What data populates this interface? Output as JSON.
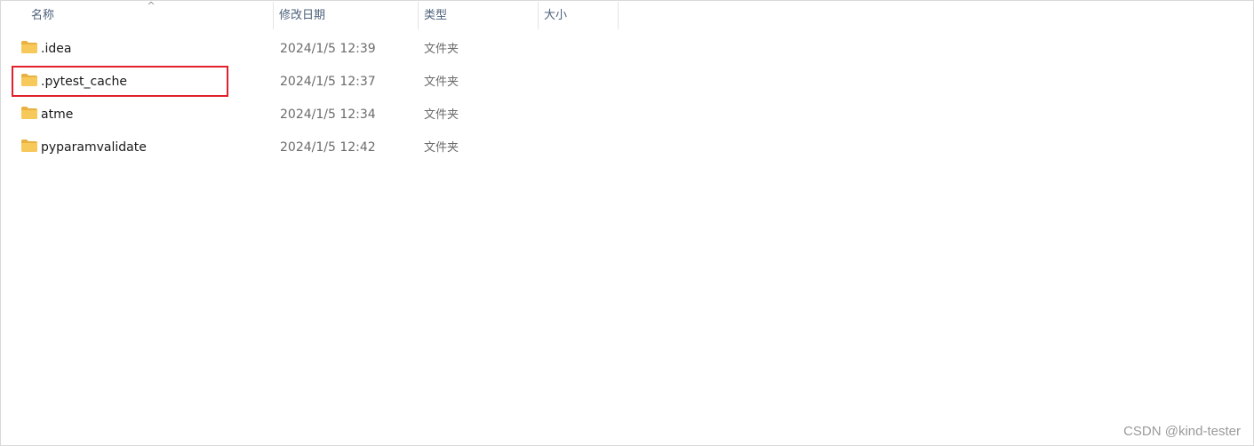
{
  "columns": {
    "name": "名称",
    "date": "修改日期",
    "type": "类型",
    "size": "大小"
  },
  "sort_indicator": "^",
  "files": [
    {
      "name": ".idea",
      "date": "2024/1/5 12:39",
      "type": "文件夹"
    },
    {
      "name": ".pytest_cache",
      "date": "2024/1/5 12:37",
      "type": "文件夹"
    },
    {
      "name": "atme",
      "date": "2024/1/5 12:34",
      "type": "文件夹"
    },
    {
      "name": "pyparamvalidate",
      "date": "2024/1/5 12:42",
      "type": "文件夹"
    }
  ],
  "highlighted_item": ".pytest_cache",
  "watermark": "CSDN @kind-tester",
  "colors": {
    "folder": "#f7c95b",
    "highlight": "#e0202a",
    "header_text": "#4c607a"
  }
}
